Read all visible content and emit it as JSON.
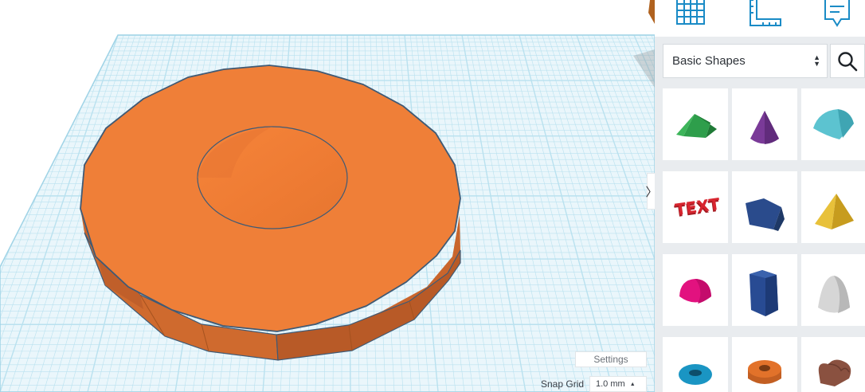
{
  "viewport": {
    "settings_label": "Settings",
    "snap_grid_label": "Snap Grid",
    "snap_grid_value": "1.0 mm"
  },
  "panel": {
    "toggle_glyph": "〉",
    "top_icons": [
      "grid-icon",
      "ruler-icon",
      "notes-icon"
    ],
    "category": "Basic Shapes",
    "search_icon": "search-icon",
    "shapes": [
      {
        "name": "roof",
        "color": "#2e9e4b"
      },
      {
        "name": "cone",
        "color": "#7a3a98"
      },
      {
        "name": "round-roof",
        "color": "#5cc3d0"
      },
      {
        "name": "text",
        "color": "#d8252f",
        "label": "TEXT"
      },
      {
        "name": "polygon",
        "color": "#2a4b8c"
      },
      {
        "name": "pyramid",
        "color": "#e8c13a"
      },
      {
        "name": "half-sphere",
        "color": "#e2127f"
      },
      {
        "name": "hexagonal-prism",
        "color": "#284b93"
      },
      {
        "name": "paraboloid",
        "color": "#d6d6d6"
      },
      {
        "name": "torus",
        "color": "#1a95c3"
      },
      {
        "name": "tube",
        "color": "#e2722a"
      },
      {
        "name": "heart",
        "color": "#8a5140"
      }
    ]
  },
  "colors": {
    "shape_orange": "#ef7f38",
    "grid_line": "#b9e1ef",
    "panel_bg": "#e9ecef"
  }
}
